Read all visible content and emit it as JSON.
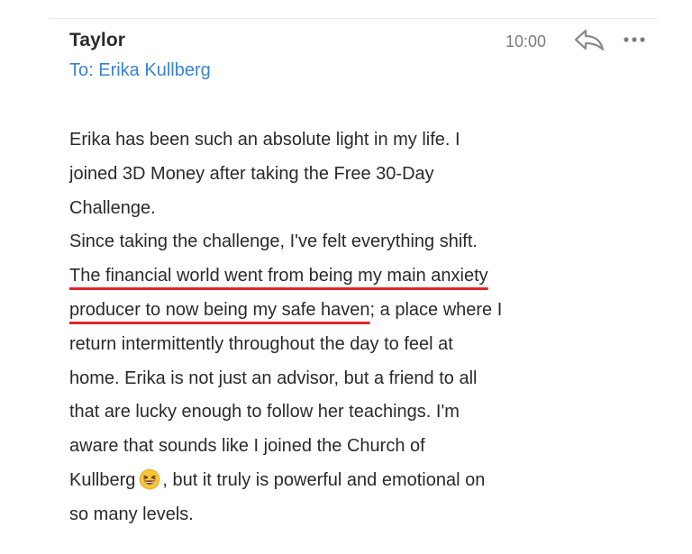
{
  "email": {
    "sender": "Taylor",
    "recipient": "To: Erika Kullberg",
    "time": "10:00",
    "icons": {
      "reply": "reply-icon",
      "more": "more-options-icon",
      "emoji": "grinning-squinting-face-emoji"
    },
    "body": {
      "l1": "Erika has been such an absolute light in my life. I",
      "l2": "joined 3D Money after taking the Free 30-Day",
      "l3": "Challenge.",
      "l4": "Since taking the challenge, I've felt everything shift.",
      "l5_highlight": "The financial world went from being my main anxiety",
      "l6_highlight": "producer to now being my safe haven",
      "l6_rest": "; a place where I",
      "l7": "return intermittently throughout the day to feel at",
      "l8": "home. Erika is not just an advisor, but a friend to all",
      "l9": "that are lucky enough to follow her teachings. I'm",
      "l10": "aware that sounds like I joined the Church of",
      "l11_before_emoji": "Kullberg",
      "l11_after_emoji": ", but it truly is powerful and emotional on",
      "l12": "so many levels."
    },
    "colors": {
      "recipient_link": "#3b82d4",
      "highlight_underline": "#e0252b",
      "time_text": "#7b7b7b"
    }
  }
}
